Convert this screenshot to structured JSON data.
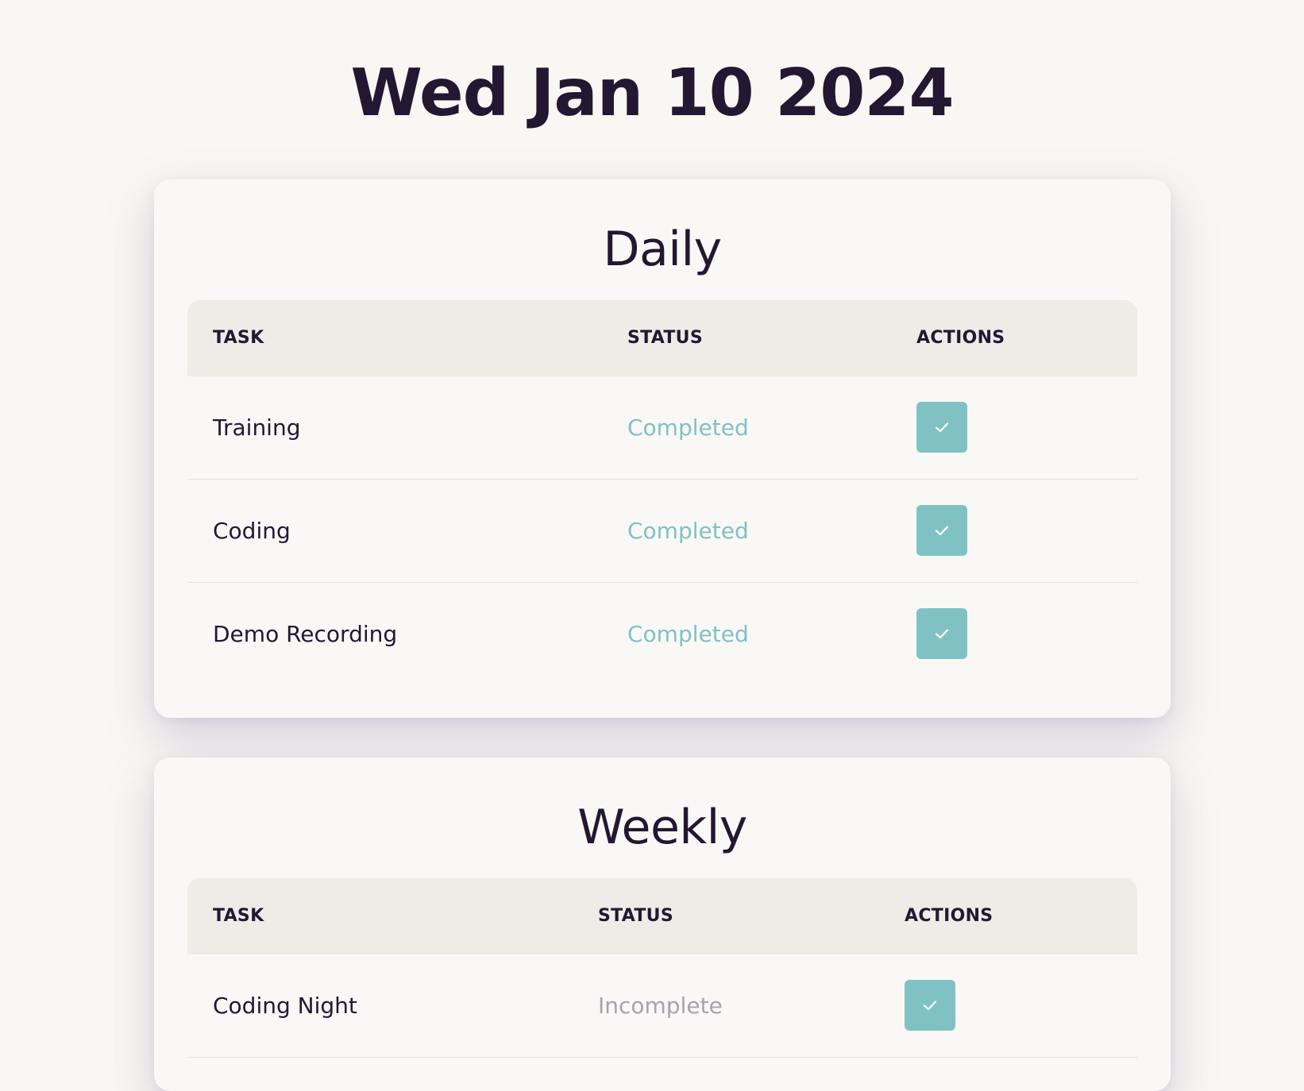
{
  "date_heading": "Wed Jan 10 2024",
  "colors": {
    "background": "#f9f6f3",
    "text": "#241732",
    "accent": "#80c2c3",
    "incomplete": "#a6a3ad",
    "table_header": "#efebe7"
  },
  "action_icon": "check-icon",
  "sections": [
    {
      "title": "Daily",
      "columns": {
        "task": "TASK",
        "status": "STATUS",
        "actions": "ACTIONS"
      },
      "rows": [
        {
          "task": "Training",
          "status": "Completed"
        },
        {
          "task": "Coding",
          "status": "Completed"
        },
        {
          "task": "Demo Recording",
          "status": "Completed"
        }
      ]
    },
    {
      "title": "Weekly",
      "columns": {
        "task": "TASK",
        "status": "STATUS",
        "actions": "ACTIONS"
      },
      "rows": [
        {
          "task": "Coding Night",
          "status": "Incomplete"
        }
      ]
    }
  ]
}
